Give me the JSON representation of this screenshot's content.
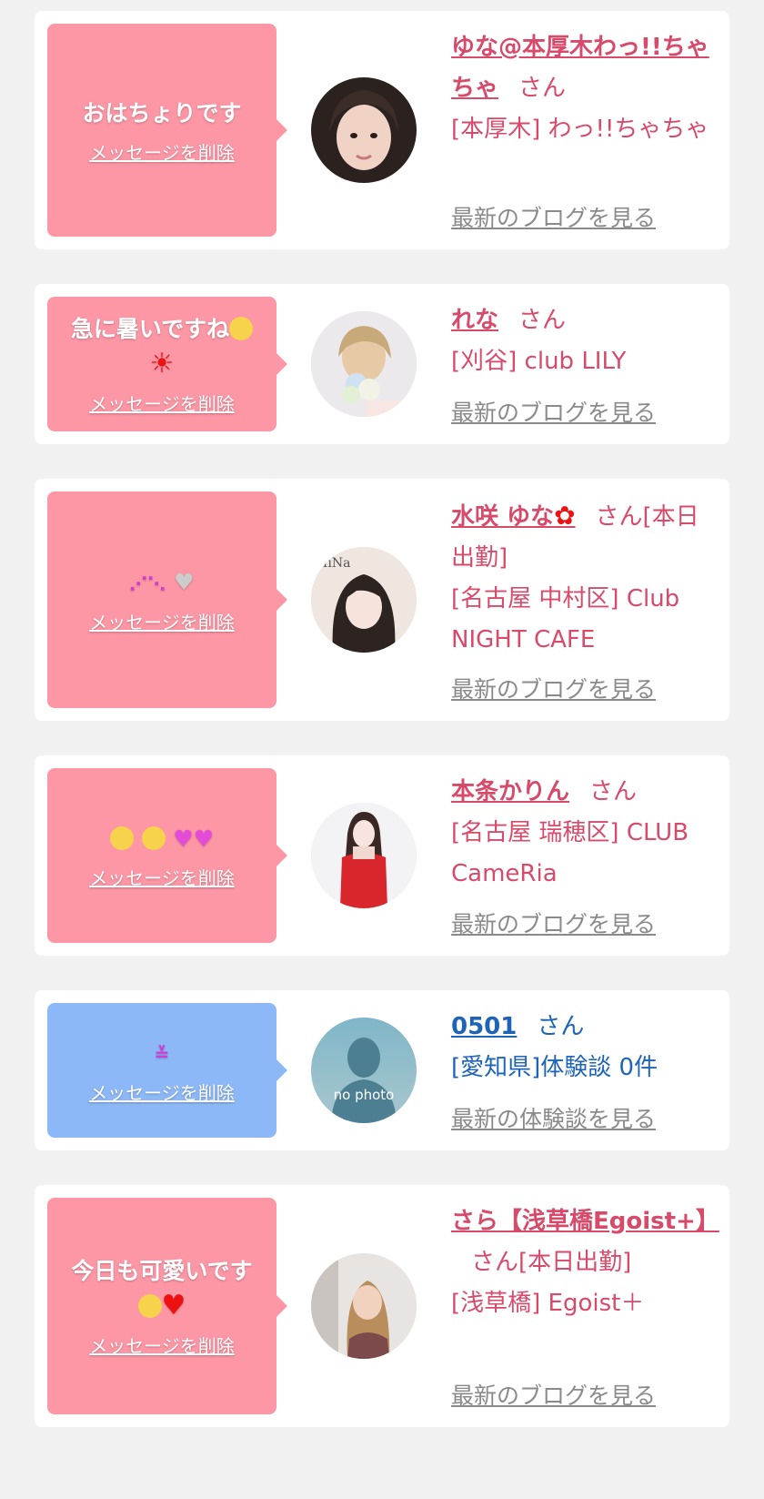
{
  "delete_label": "メッセージを削除",
  "cards": [
    {
      "message": "おはちょりです",
      "name": "ゆな@本厚木わっ!!ちゃちゃ",
      "honorific": "さん",
      "shop": "[本厚木] わっ!!ちゃちゃ",
      "link": "最新のブログを見る"
    },
    {
      "message": "急に暑いですね",
      "name": "れな",
      "honorific": "さん",
      "shop": "[刈谷] club LILY",
      "link": "最新のブログを見る"
    },
    {
      "message": "",
      "name": "水咲 ゆな",
      "honorific": "さん[本日出勤]",
      "shop": "[名古屋 中村区] Club NIGHT CAFE",
      "link": "最新のブログを見る"
    },
    {
      "message": "",
      "name": "本条かりん",
      "honorific": "さん",
      "shop": "[名古屋 瑞穂区] CLUB CameRia",
      "link": "最新のブログを見る"
    },
    {
      "message": "",
      "name": "0501",
      "honorific": "さん",
      "shop": "[愛知県]体験談 0件",
      "link": "最新の体験談を見る",
      "avatar_text": "no photo"
    },
    {
      "message": "今日も可愛いです",
      "name": "さら【浅草橋Egoist+】",
      "honorific": "さん[本日出勤]",
      "shop": "[浅草橋] Egoist＋",
      "link": "最新のブログを見る"
    }
  ],
  "colors": {
    "pink_bubble": "#fd97a6",
    "blue_bubble": "#8db8f7",
    "pink_text": "#d84a6a",
    "blue_text": "#1d64b8",
    "link_gray": "#8a8a8a"
  }
}
